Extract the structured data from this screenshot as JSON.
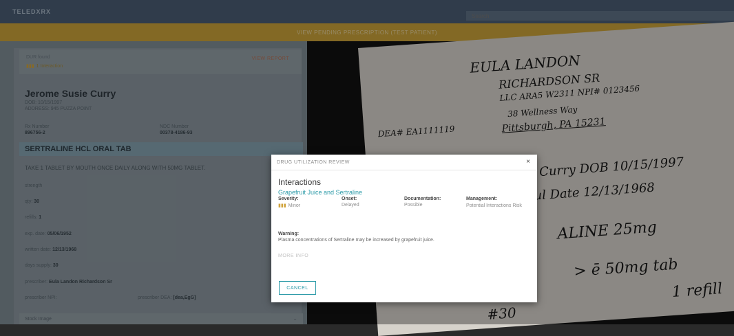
{
  "topbar": {
    "brand": "TELEDXRX",
    "search_placeholder": "Search"
  },
  "banner": {
    "text": "VIEW PENDING PRESCRIPTION (TEST PATIENT)"
  },
  "dur": {
    "label": "DUR found",
    "count": "1 Interaction",
    "report_link": "VIEW REPORT"
  },
  "patient": {
    "name": "Jerome Susie Curry",
    "dob": "DOB: 10/15/1997",
    "address": "ADDRESS: 945 PUZZA POINT",
    "rx_number_label": "Rx Number",
    "rx_number": "896756-2",
    "ndc_label": "NDC Number",
    "ndc": "00378-4186-93"
  },
  "drug": {
    "name": "SERTRALINE HCL ORAL TAB",
    "sig": "TAKE 1 TABLET BY MOUTH ONCE DAILY ALONG WITH 50MG TABLET.",
    "strength_label": "strength",
    "qty_label": "qty:",
    "qty": "30",
    "refills_label": "refills:",
    "refills": "1",
    "exp_label": "exp. date:",
    "exp": "05/06/1952",
    "written_label": "written date:",
    "written": "12/13/1968",
    "days_label": "days supply:",
    "days": "30",
    "prescriber_label": "prescriber:",
    "prescriber": "Eula Landon Richardson Sr",
    "npi_label": "prescriber NPI:",
    "dea_label": "prescriber DEA:",
    "dea": "[dea,EgG]"
  },
  "stock": {
    "label": "Stock Image",
    "icon": "chevron-down-icon"
  },
  "handwriting": {
    "l1": "EULA LANDON",
    "l2": "RICHARDSON SR",
    "l3": "LLC ARA5 W2311  NPI# 0123456",
    "l4": "38 Wellness Way",
    "l5": "Pittsburgh, PA 15231",
    "l6": "DEA# EA1111119",
    "l7": "Curry  DOB 10/15/1997",
    "l8": "ul       Date 12/13/1968",
    "l9": "ALINE 25mg",
    "l10": "> ē 50mg tab",
    "l11": "#30",
    "l12": "1 refill"
  },
  "modal": {
    "header": "DRUG UTILIZATION REVIEW",
    "close": "×",
    "title": "Interactions",
    "interaction": "Grapefruit Juice and Sertraline",
    "severity_label": "Severity:",
    "severity": "Minor",
    "onset_label": "Onset:",
    "onset": "Delayed",
    "documentation_label": "Documentation:",
    "documentation": "Possible",
    "management_label": "Management:",
    "management": "Potential Interactions Risk",
    "warning_label": "Warning:",
    "warning": "Plasma concentrations of Sertraline may be increased by grapefruit juice.",
    "more": "MORE INFO",
    "cancel": "CANCEL"
  },
  "colors": {
    "accent": "#2b9aa8",
    "banner": "#c9a23a",
    "topbar": "#4a5d73"
  }
}
